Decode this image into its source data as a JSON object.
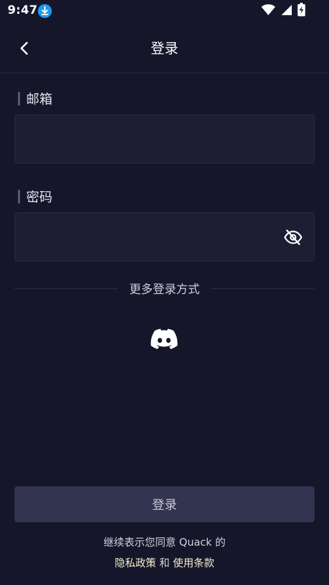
{
  "status_bar": {
    "time": "9:47",
    "icons": [
      "download-icon",
      "wifi-icon",
      "signal-icon",
      "battery-charging-icon"
    ]
  },
  "header": {
    "title": "登录",
    "back_icon": "chevron-left-icon"
  },
  "email": {
    "label": "邮箱",
    "value": "",
    "placeholder": ""
  },
  "password": {
    "label": "密码",
    "value": "",
    "placeholder": "",
    "toggle_icon": "eye-off-icon"
  },
  "more_login": {
    "label": "更多登录方式",
    "providers": [
      "discord-icon"
    ]
  },
  "login_button": {
    "label": "登录"
  },
  "terms": {
    "line1": "继续表示您同意 Quack 的",
    "privacy_link": "隐私政策",
    "conjunction": " 和 ",
    "terms_link": "使用条款"
  },
  "colors": {
    "background": "#16162b",
    "input_background": "#1d1d33",
    "button_background": "#33344f",
    "link": "#f2eecb",
    "download_badge": "#1e9bf0"
  }
}
